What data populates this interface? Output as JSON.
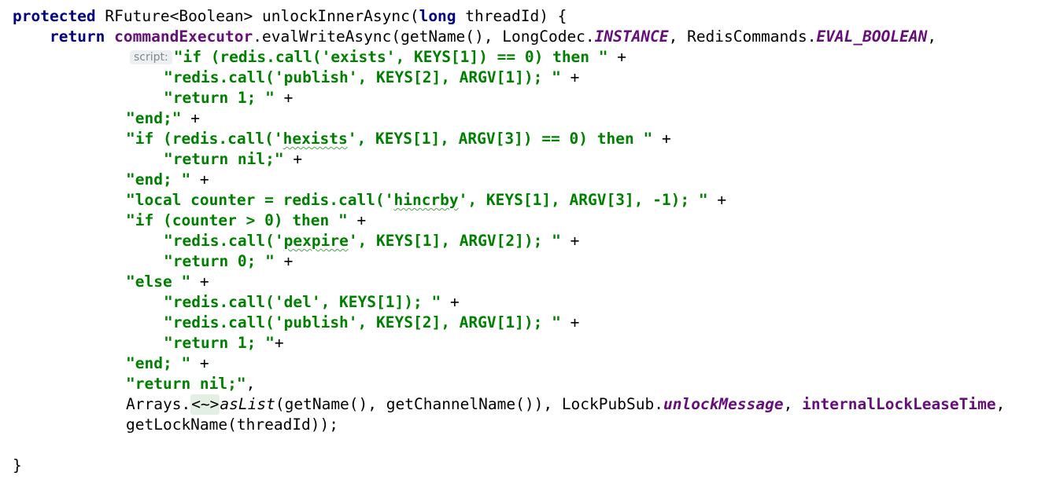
{
  "editor": {
    "line1": {
      "kw_protected": "protected",
      "sig": " RFuture<Boolean> unlockInnerAsync(",
      "kw_long": "long",
      "sig_end": " threadId) {"
    },
    "line2": {
      "kw_return": "return",
      "sp": " ",
      "field_executor": "commandExecutor",
      "call": ".evalWriteAsync(getName(), LongCodec.",
      "sfield_instance": "INSTANCE",
      "mid": ", RedisCommands.",
      "sfield_eval": "EVAL_BOOLEAN",
      "end": ","
    },
    "param_hint": "script:",
    "line3": {
      "str": "\"if (redis.call('exists', KEYS[1]) == 0) then \"",
      "op": " +"
    },
    "line4": {
      "str": "\"redis.call('publish', KEYS[2], ARGV[1]); \"",
      "op": " +"
    },
    "line5": {
      "str": "\"return 1; \"",
      "op": " +"
    },
    "line6": {
      "str": "\"end;\"",
      "op": " +"
    },
    "line7": {
      "str_a": "\"if (redis.call('",
      "str_typo": "hexists",
      "str_b": "', KEYS[1], ARGV[3]) == 0) then \"",
      "op": " +"
    },
    "line8": {
      "str": "\"return nil;\"",
      "op": " +"
    },
    "line9": {
      "str": "\"end; \"",
      "op": " +"
    },
    "line10": {
      "str_a": "\"local counter = redis.call('",
      "str_typo": "hincrby",
      "str_b": "', KEYS[1], ARGV[3], -1); \"",
      "op": " +"
    },
    "line11": {
      "str": "\"if (counter > 0) then \"",
      "op": " +"
    },
    "line12": {
      "str_a": "\"redis.call('",
      "str_typo": "pexpire",
      "str_b": "', KEYS[1], ARGV[2]); \"",
      "op": " +"
    },
    "line13": {
      "str": "\"return 0; \"",
      "op": " +"
    },
    "line14": {
      "str": "\"else \"",
      "op": " +"
    },
    "line15": {
      "str": "\"redis.call('del', KEYS[1]); \"",
      "op": " +"
    },
    "line16": {
      "str": "\"redis.call('publish', KEYS[2], ARGV[1]); \"",
      "op": " +"
    },
    "line17": {
      "str": "\"return 1; \"",
      "op": "+"
    },
    "line18": {
      "str": "\"end; \"",
      "op": " +"
    },
    "line19": {
      "str": "\"return nil;\"",
      "op": ","
    },
    "line20": {
      "pre": "Arrays.",
      "fold": "<~>",
      "method": "asList",
      "mid": "(getName(), getChannelName()), LockPubSub.",
      "sfield_unlock": "unlockMessage",
      "sep": ", ",
      "field_lease": "internalLockLeaseTime",
      "end": ","
    },
    "line21": {
      "text": "getLockName(threadId));"
    },
    "line22": {
      "text": "}"
    }
  },
  "colors": {
    "keyword": "#000080",
    "string": "#008000",
    "field": "#660e7a",
    "hint_bg": "#edf0f2",
    "hint_text": "#878787",
    "typo_underline": "#4fa34f"
  }
}
